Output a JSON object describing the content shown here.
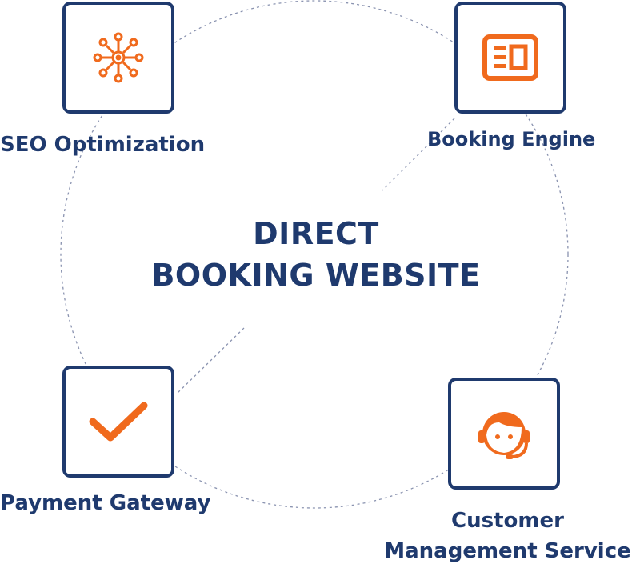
{
  "center": {
    "line1": "DIRECT",
    "line2": "BOOKING WEBSITE"
  },
  "nodes": {
    "seo": {
      "label": "SEO Optimization",
      "icon": "network-hub-icon"
    },
    "booking": {
      "label": "Booking Engine",
      "icon": "booking-card-icon"
    },
    "payment": {
      "label": "Payment Gateway",
      "icon": "checkmark-icon"
    },
    "customer": {
      "label_line1": "Customer",
      "label_line2": "Management Service",
      "icon": "customer-support-headset-icon"
    }
  },
  "colors": {
    "navy": "#1f3a6e",
    "accent": "#f06a1d",
    "dashed_line": "#8a93b0"
  }
}
